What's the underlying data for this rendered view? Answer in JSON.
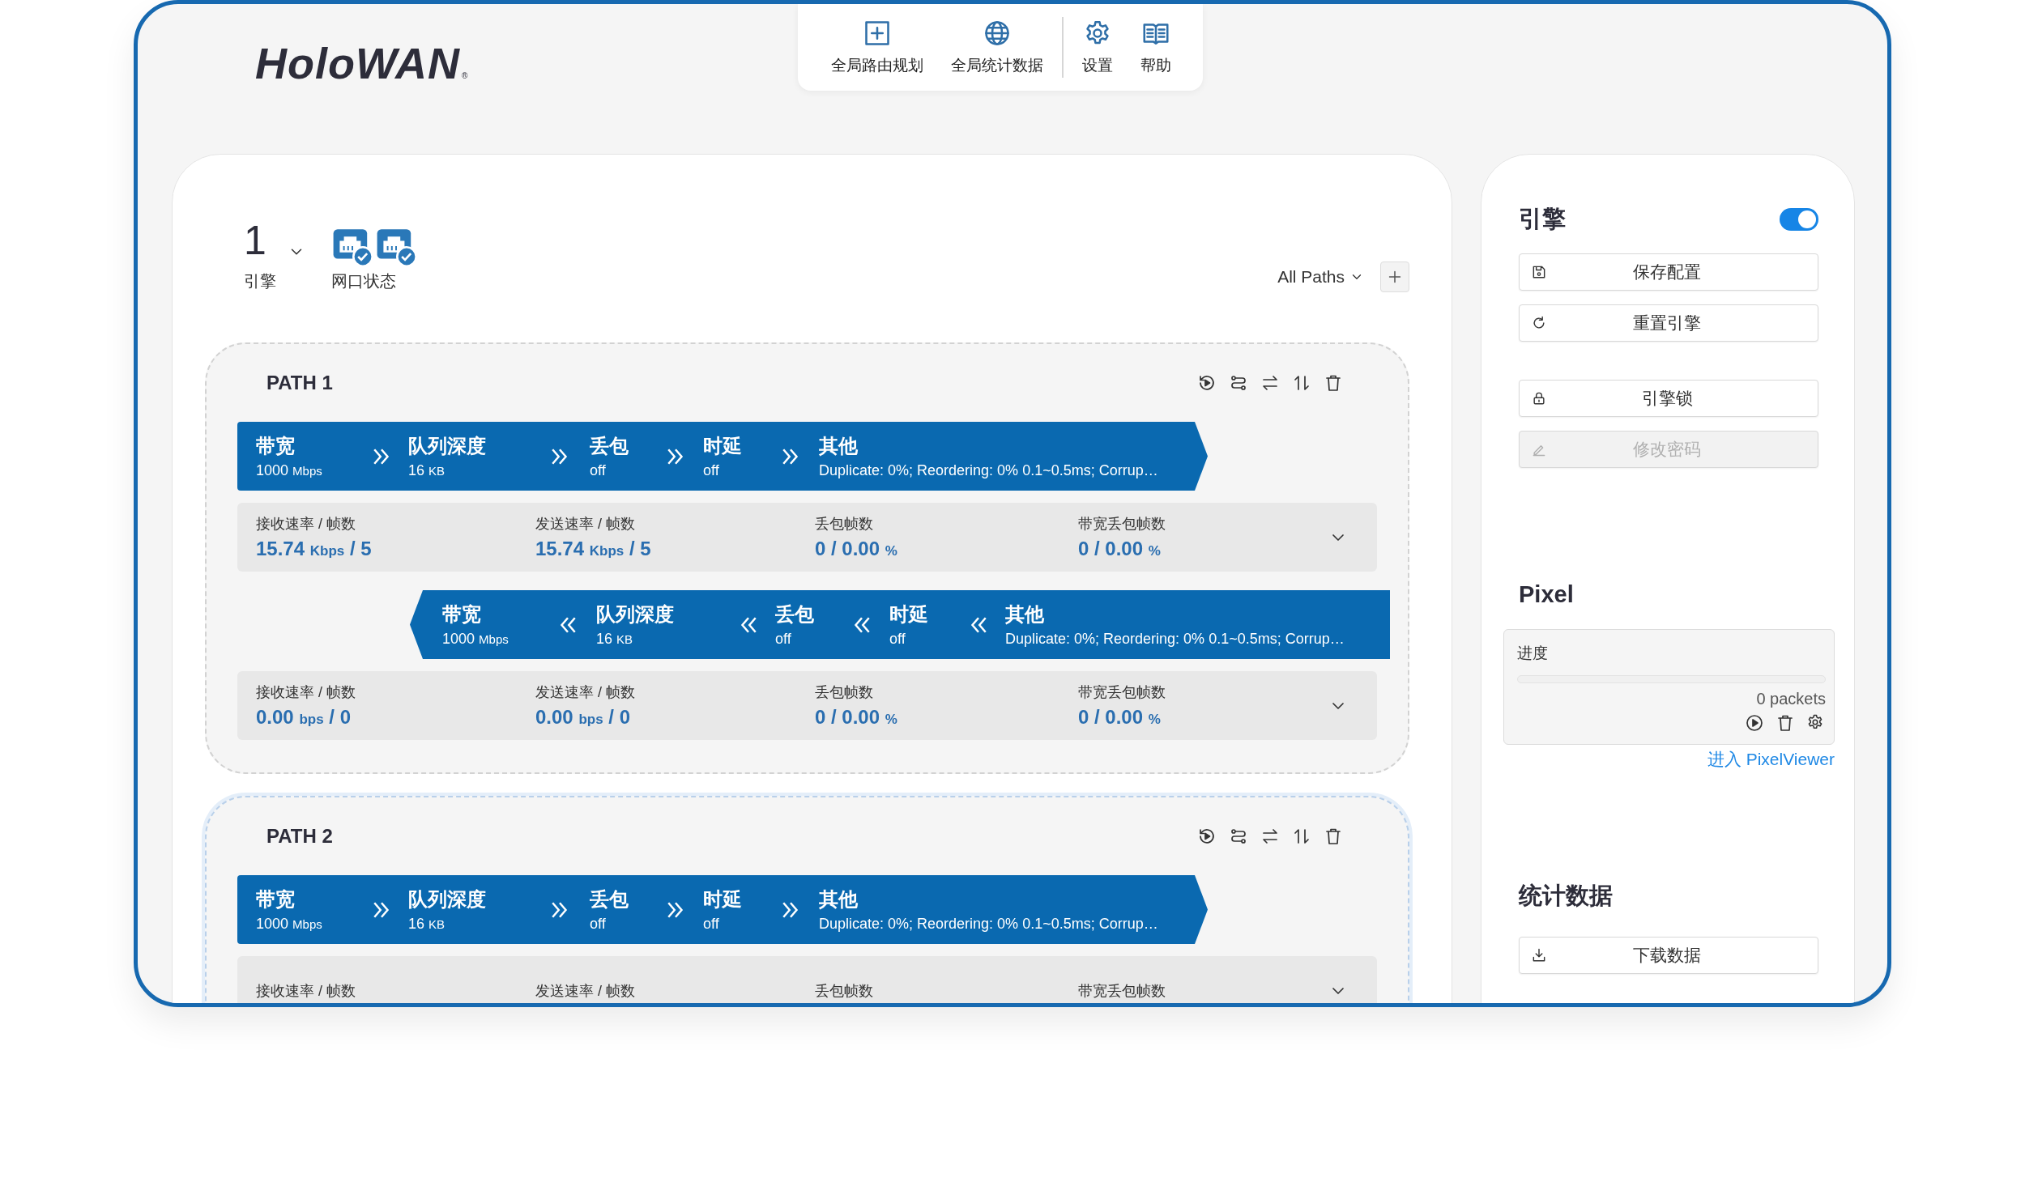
{
  "logo": {
    "name": "HoloWAN",
    "mark": "®"
  },
  "toolbar": [
    {
      "label": "全局路由规划"
    },
    {
      "label": "全局统计数据"
    },
    {
      "label": "设置"
    },
    {
      "label": "帮助"
    }
  ],
  "engine_selector": {
    "value": "1",
    "label": "引擎"
  },
  "port_status": {
    "label": "网口状态",
    "ports": [
      {
        "connected": true
      },
      {
        "connected": true
      }
    ]
  },
  "path_filter": {
    "value": "All Paths"
  },
  "paths": [
    {
      "title": "PATH 1",
      "selected": false,
      "lanes": [
        {
          "kind": "forward",
          "stages": [
            {
              "label": "带宽",
              "value": "1000",
              "unit": "Mbps"
            },
            {
              "label": "队列深度",
              "value": "16",
              "unit": "KB"
            },
            {
              "label": "丢包",
              "value": "off"
            },
            {
              "label": "时延",
              "value": "off"
            },
            {
              "label": "其他",
              "value": "Duplicate: 0%; Reordering: 0% 0.1~0.5ms; Corrup…"
            }
          ],
          "stats": [
            {
              "label": "接收速率 / 帧数",
              "value": "15.74",
              "unit": "Kbps",
              "tail": "/ 5"
            },
            {
              "label": "发送速率 / 帧数",
              "value": "15.74",
              "unit": "Kbps",
              "tail": "/ 5"
            },
            {
              "label": "丢包帧数",
              "value": "0 / 0.00",
              "unit": "%"
            },
            {
              "label": "带宽丢包帧数",
              "value": "0 / 0.00",
              "unit": "%"
            }
          ]
        },
        {
          "kind": "reverse",
          "stages": [
            {
              "label": "带宽",
              "value": "1000",
              "unit": "Mbps"
            },
            {
              "label": "队列深度",
              "value": "16",
              "unit": "KB"
            },
            {
              "label": "丢包",
              "value": "off"
            },
            {
              "label": "时延",
              "value": "off"
            },
            {
              "label": "其他",
              "value": "Duplicate: 0%; Reordering: 0% 0.1~0.5ms; Corrup…"
            }
          ],
          "stats": [
            {
              "label": "接收速率 / 帧数",
              "value": "0.00",
              "unit": "bps",
              "tail": "/ 0"
            },
            {
              "label": "发送速率 / 帧数",
              "value": "0.00",
              "unit": "bps",
              "tail": "/ 0"
            },
            {
              "label": "丢包帧数",
              "value": "0 / 0.00",
              "unit": "%"
            },
            {
              "label": "带宽丢包帧数",
              "value": "0 / 0.00",
              "unit": "%"
            }
          ]
        }
      ]
    },
    {
      "title": "PATH 2",
      "selected": true,
      "lanes": [
        {
          "kind": "forward",
          "stages": [
            {
              "label": "带宽",
              "value": "1000",
              "unit": "Mbps"
            },
            {
              "label": "队列深度",
              "value": "16",
              "unit": "KB"
            },
            {
              "label": "丢包",
              "value": "off"
            },
            {
              "label": "时延",
              "value": "off"
            },
            {
              "label": "其他",
              "value": "Duplicate: 0%; Reordering: 0% 0.1~0.5ms; Corrup…"
            }
          ],
          "stats": [
            {
              "label": "接收速率 / 帧数"
            },
            {
              "label": "发送速率 / 帧数"
            },
            {
              "label": "丢包帧数"
            },
            {
              "label": "带宽丢包帧数"
            }
          ]
        }
      ]
    }
  ],
  "engine": {
    "title": "引擎",
    "enabled": true,
    "buttons": [
      {
        "label": "保存配置",
        "disabled": false
      },
      {
        "label": "重置引擎",
        "disabled": false
      },
      {
        "label": "引擎锁",
        "disabled": false
      },
      {
        "label": "修改密码",
        "disabled": true
      }
    ]
  },
  "pixel": {
    "title": "Pixel",
    "progress_label": "进度",
    "level": 0,
    "count": "0 packets",
    "link": "进入 PixelViewer"
  },
  "statistics": {
    "title": "统计数据",
    "buttons": [
      {
        "label": "下载数据",
        "disabled": false
      }
    ]
  }
}
